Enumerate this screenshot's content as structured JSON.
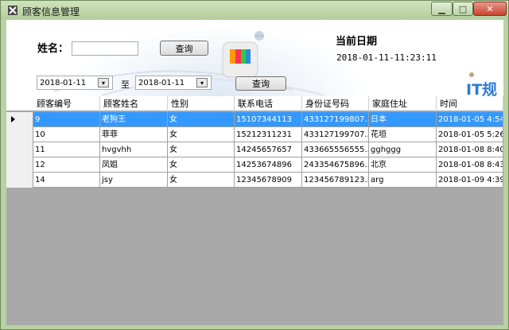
{
  "window": {
    "title": "顾客信息管理"
  },
  "form": {
    "name_label": "姓名：",
    "name_value": "",
    "query_label_1": "查询",
    "query_label_2": "查询",
    "date_from": "2018-01-11",
    "date_to": "2018-01-11",
    "to_label": "至",
    "current_date_label": "当前日期",
    "current_date_value": "2018-01-11-11:23:11",
    "brand_text": "IT规"
  },
  "table": {
    "columns": [
      "顾客编号",
      "顾客姓名",
      "性别",
      "联系电话",
      "身份证号码",
      "家庭住址",
      "时间"
    ],
    "rows": [
      [
        "9",
        "老狗王",
        "女",
        "15107344113",
        "433127199807...",
        "日本",
        "2018-01-05 4:54"
      ],
      [
        "10",
        "菲菲",
        "女",
        "15212311231",
        "433127199707...",
        "花垣",
        "2018-01-05 5:26"
      ],
      [
        "11",
        "hvgvhh",
        "女",
        "14245657657",
        "433665556555...",
        "gghggg",
        "2018-01-08 8:40"
      ],
      [
        "12",
        "凤姐",
        "女",
        "14253674896",
        "243354675896...",
        "北京",
        "2018-01-08 8:43"
      ],
      [
        "14",
        "jsy",
        "女",
        "12345678909",
        "123456789123...",
        "arg",
        "2018-01-09 4:39"
      ]
    ],
    "selected_row": 0
  }
}
